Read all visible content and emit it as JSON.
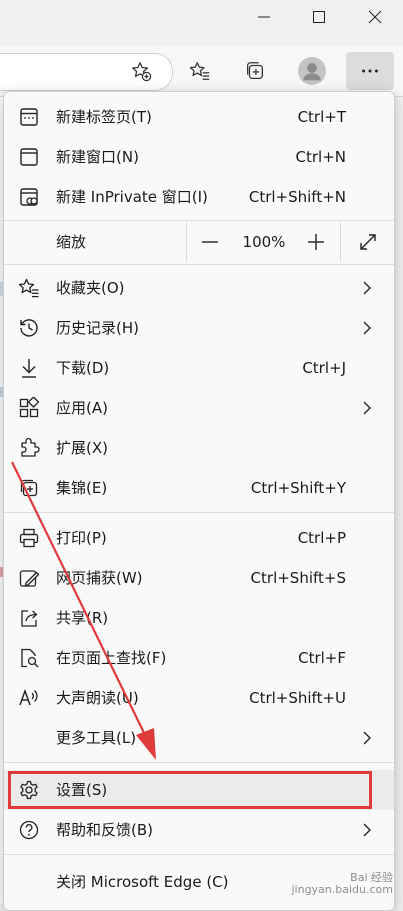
{
  "window": {
    "minimize_icon": "minimize-icon",
    "maximize_icon": "maximize-icon",
    "close_icon": "close-icon"
  },
  "toolbar": {
    "favorite_add_icon": "star-add-icon",
    "favorites_icon": "favorites-icon",
    "collections_icon": "collections-icon",
    "profile_icon": "avatar-icon",
    "more_icon": "ellipsis-icon"
  },
  "menu": {
    "items": [
      {
        "label": "新建标签页(T)",
        "shortcut": "Ctrl+T",
        "icon": "new-tab-icon"
      },
      {
        "label": "新建窗口(N)",
        "shortcut": "Ctrl+N",
        "icon": "new-window-icon"
      },
      {
        "label": "新建 InPrivate 窗口(I)",
        "shortcut": "Ctrl+Shift+N",
        "icon": "inprivate-icon"
      },
      {
        "label": "缩放",
        "zoom_value": "100%",
        "icon": ""
      },
      {
        "label": "收藏夹(O)",
        "icon": "favorites-icon"
      },
      {
        "label": "历史记录(H)",
        "icon": "history-icon"
      },
      {
        "label": "下载(D)",
        "shortcut": "Ctrl+J",
        "icon": "download-icon"
      },
      {
        "label": "应用(A)",
        "icon": "apps-icon"
      },
      {
        "label": "扩展(X)",
        "icon": "extensions-icon"
      },
      {
        "label": "集锦(E)",
        "shortcut": "Ctrl+Shift+Y",
        "icon": "collections-icon"
      },
      {
        "label": "打印(P)",
        "shortcut": "Ctrl+P",
        "icon": "print-icon"
      },
      {
        "label": "网页捕获(W)",
        "shortcut": "Ctrl+Shift+S",
        "icon": "capture-icon"
      },
      {
        "label": "共享(R)",
        "icon": "share-icon"
      },
      {
        "label": "在页面上查找(F)",
        "shortcut": "Ctrl+F",
        "icon": "find-icon"
      },
      {
        "label": "大声朗读(U)",
        "shortcut": "Ctrl+Shift+U",
        "icon": "read-aloud-icon"
      },
      {
        "label": "更多工具(L)",
        "icon": ""
      },
      {
        "label": "设置(S)",
        "icon": "gear-icon"
      },
      {
        "label": "帮助和反馈(B)",
        "icon": "help-icon"
      },
      {
        "label": "关闭 Microsoft Edge (C)",
        "icon": ""
      }
    ]
  },
  "annotation": {
    "highlight_color": "#e03b3b"
  },
  "watermark": {
    "line1": "Bai 经验",
    "line2": "jingyan.baidu.com"
  }
}
